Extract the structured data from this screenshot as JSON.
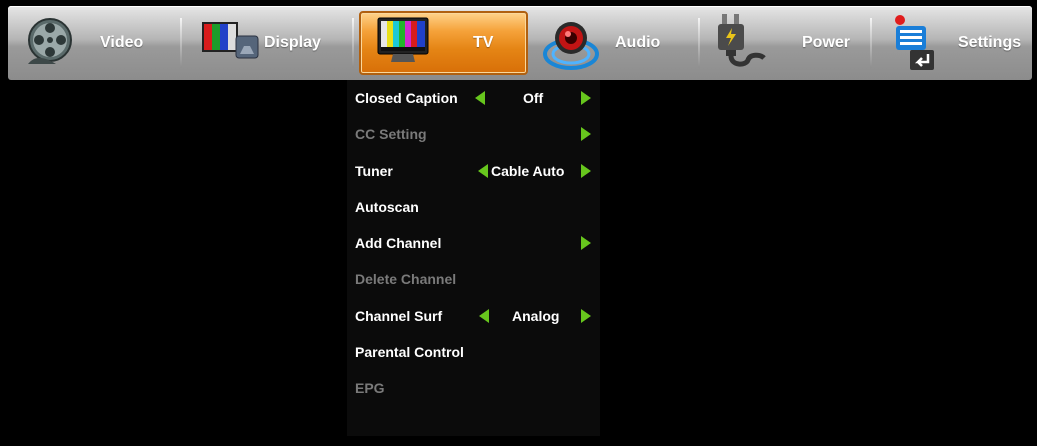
{
  "menu": {
    "tabs": [
      {
        "label": "Video",
        "icon": "film-reel-icon",
        "active": false
      },
      {
        "label": "Display",
        "icon": "display-icon",
        "active": false
      },
      {
        "label": "TV",
        "icon": "tv-icon",
        "active": true
      },
      {
        "label": "Audio",
        "icon": "speaker-icon",
        "active": false
      },
      {
        "label": "Power",
        "icon": "power-plug-icon",
        "active": false
      },
      {
        "label": "Settings",
        "icon": "settings-list-icon",
        "active": false
      }
    ],
    "active_color": "#e58515"
  },
  "tv_menu": {
    "items": [
      {
        "label": "Closed Caption",
        "value": "Off",
        "enabled": true
      },
      {
        "label": "CC Setting",
        "value": "",
        "enabled": false
      },
      {
        "label": "Tuner",
        "value": "Cable Auto",
        "enabled": true
      },
      {
        "label": "Autoscan",
        "value": "",
        "enabled": true
      },
      {
        "label": "Add Channel",
        "value": "",
        "enabled": true
      },
      {
        "label": "Delete Channel",
        "value": "",
        "enabled": false
      },
      {
        "label": "Channel Surf",
        "value": "Analog",
        "enabled": true
      },
      {
        "label": "Parental Control",
        "value": "",
        "enabled": true
      },
      {
        "label": "EPG",
        "value": "",
        "enabled": false
      }
    ],
    "arrow_color": "#67c61d",
    "disabled_color": "#7a7a7a"
  }
}
